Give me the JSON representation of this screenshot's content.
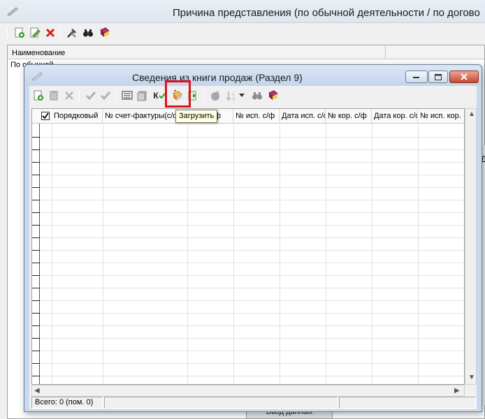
{
  "background_window": {
    "title": "Причина представления (по обычной деятельности / по догово",
    "column_header": "Наименование",
    "row_text": "По обычной",
    "bottom_button": "Ввод данных",
    "right_edge_mark": "Д",
    "toolbar_icons": [
      "add-icon",
      "edit-icon",
      "delete-icon",
      "tools-icon",
      "binoculars-icon",
      "book-icon"
    ]
  },
  "dialog": {
    "title": "Сведения из книги продаж (Раздел 9)",
    "toolbar_icons": [
      "add-icon",
      "copy-icon",
      "delete-icon",
      "check-icon",
      "check-all-icon",
      "calculator-icon",
      "pages-icon",
      "k-check-icon",
      "load-icon",
      "export-icon",
      "clear-icon",
      "sort-icon",
      "dropdown-arrow-icon",
      "binoculars-icon",
      "book-icon"
    ],
    "columns": [
      "Порядковый",
      "№ счет-фактуры(с/ф)",
      "Дата с/ф",
      "№ исп. с/ф",
      "Дата исп. с/ф",
      "№ кор. с/ф",
      "Дата кор. с/ф",
      "№ исп. кор."
    ],
    "k_label": "К",
    "tooltip": "Загрузить",
    "status": {
      "total": "Всего: 0 (пом. 0)",
      "cell2": "",
      "cell3": ""
    }
  },
  "colors": {
    "highlight": "#e0101a",
    "dialog_frame": "#c9daee",
    "tooltip_bg": "#ffffe1"
  }
}
